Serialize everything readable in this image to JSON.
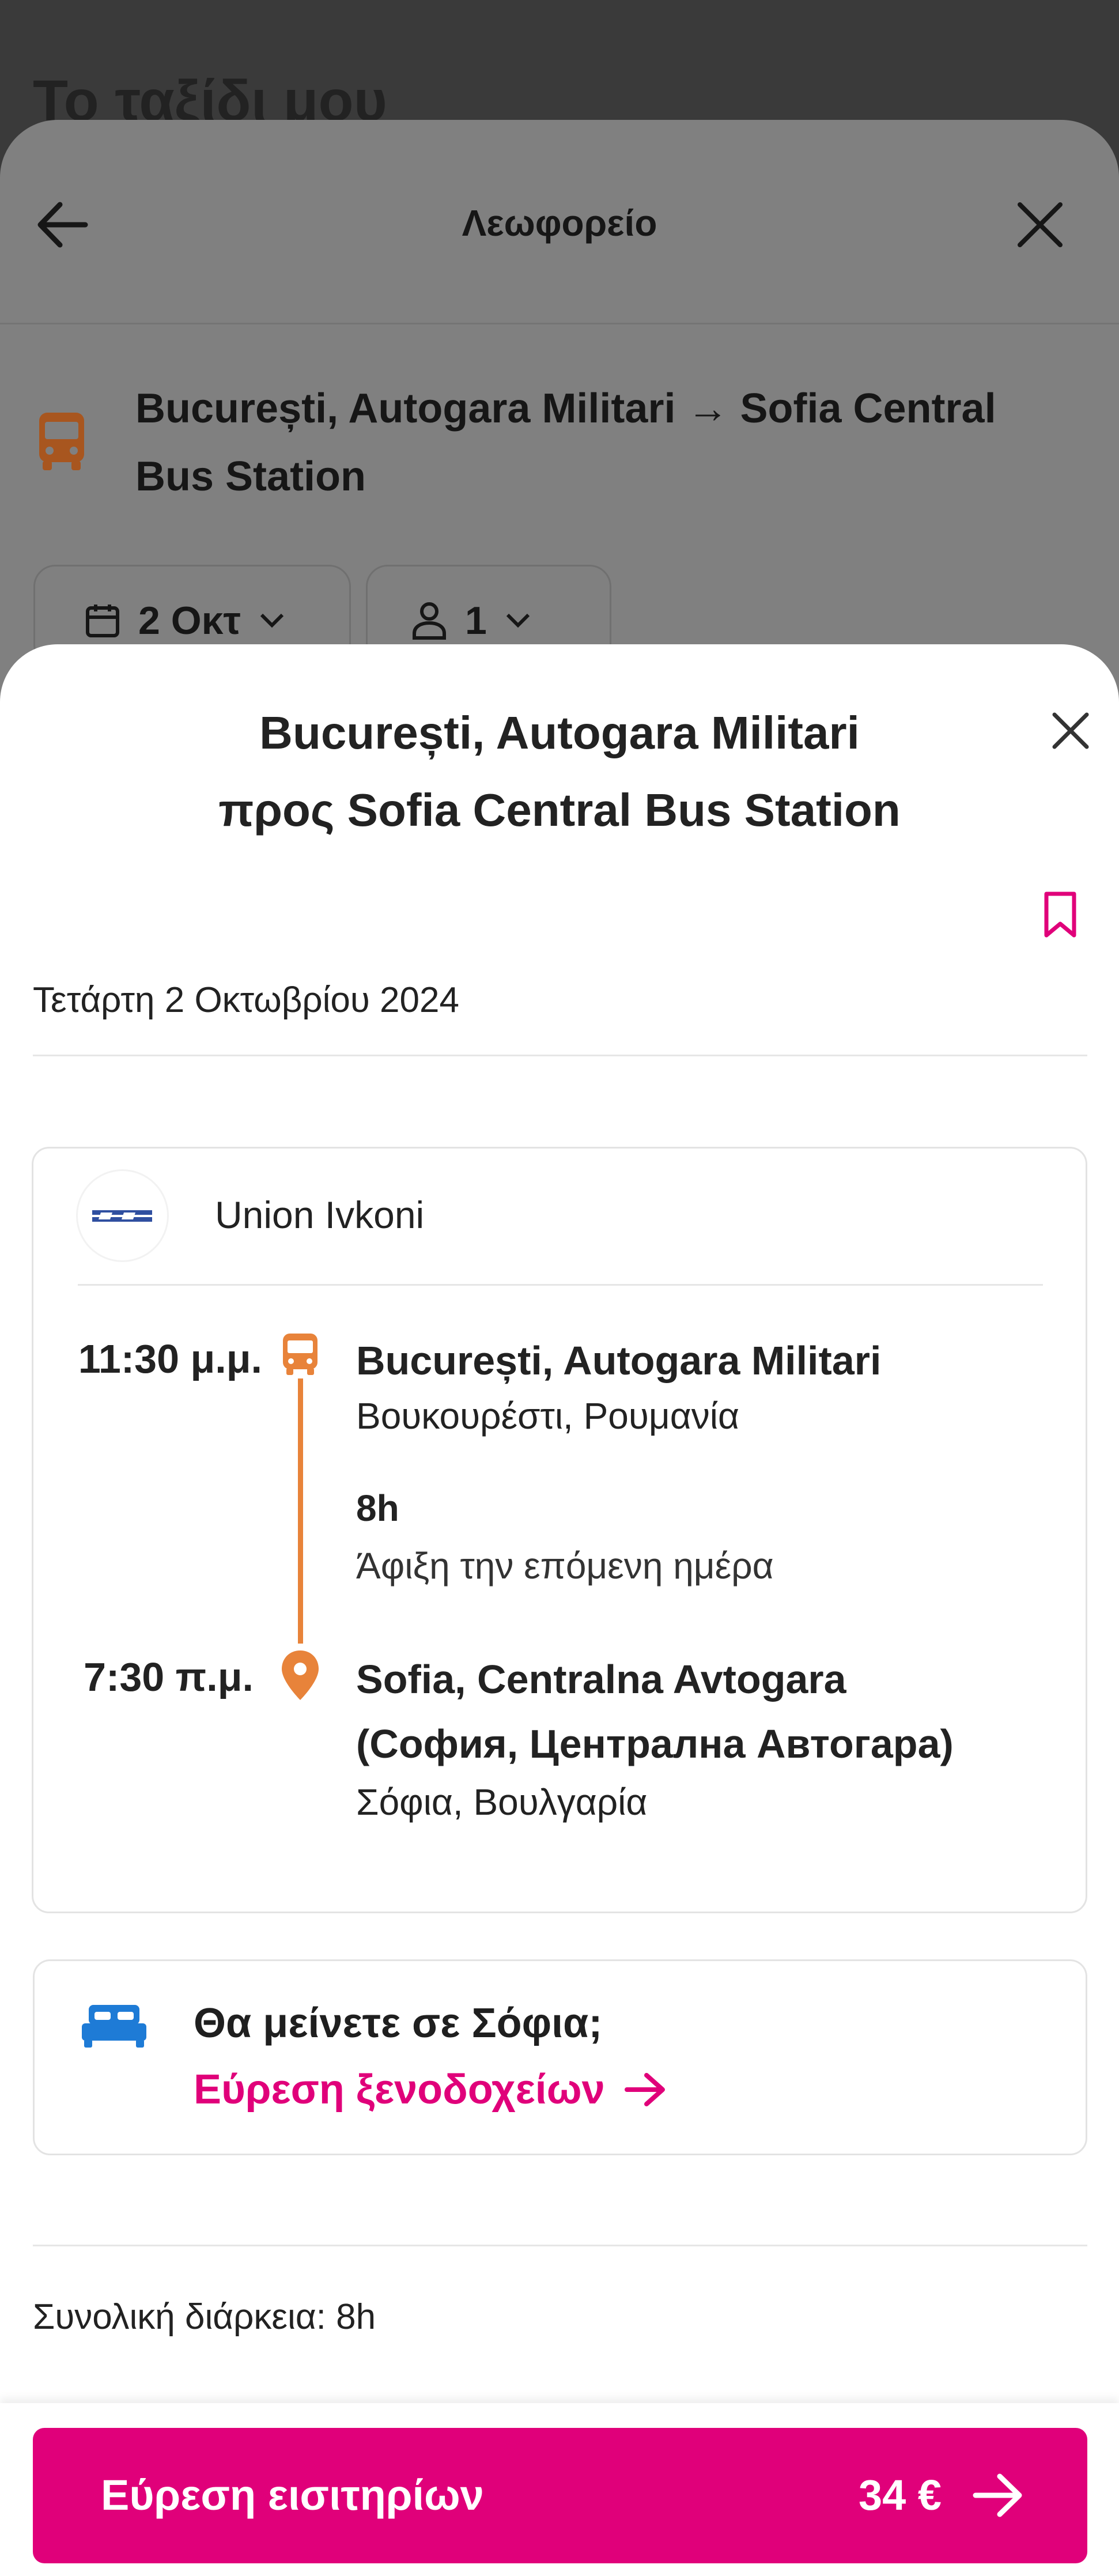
{
  "background_page": {
    "title": "Το ταξίδι μου",
    "sheet_title": "Λεωφορείο",
    "back_icon": "arrow-left-icon",
    "close_icon": "close-icon",
    "route": "București, Autogara Militari → Sofia Central Bus Station",
    "date_filter": "2 Οκτ",
    "passengers_filter": "1"
  },
  "modal": {
    "title_line1": "București, Autogara Militari",
    "title_line2": "προς Sofia Central Bus Station",
    "date": "Τετάρτη 2 Οκτωβρίου 2024",
    "operator": "Union Ivkoni",
    "departure": {
      "time": "11:30 μ.μ.",
      "stop": "București, Autogara Militari",
      "city": "Βουκουρέστι, Ρουμανία"
    },
    "duration": "8h",
    "arrival_note": "Άφιξη την επόμενη ημέρα",
    "arrival": {
      "time": "7:30 π.μ.",
      "stop_line1": "Sofia, Centralna Avtogara",
      "stop_line2": "(София, Централна Автогара)",
      "city": "Σόφια, Βουλγαρία"
    },
    "hotel": {
      "question": "Θα μείνετε σε Σόφια;",
      "link": "Εύρεση ξενοδοχείων"
    },
    "total_duration": "Συνολική διάρκεια: 8h"
  },
  "footer": {
    "cta_label": "Εύρεση εισιτηρίων",
    "price": "34 €"
  },
  "colors": {
    "accent": "#e0007a",
    "timeline": "#e8833a",
    "hotel_icon": "#1e7bd6",
    "overlay": "#808080"
  }
}
